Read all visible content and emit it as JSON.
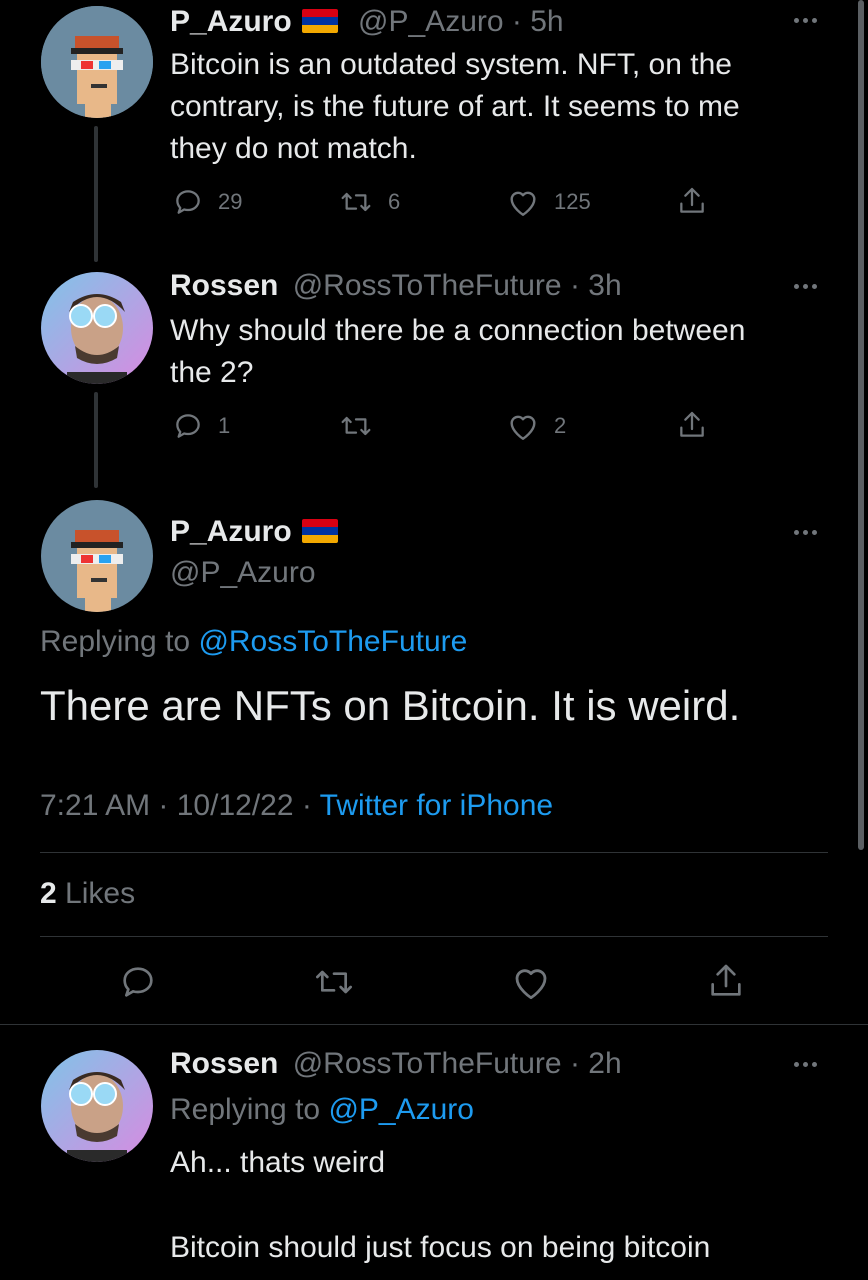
{
  "tweets": [
    {
      "name": "P_Azuro",
      "handle": "@P_Azuro",
      "time": "5h",
      "text_lines": [
        "Bitcoin is an outdated system. NFT, on the",
        "contrary, is the future of art. It seems to me",
        "they do not match."
      ],
      "replies": "29",
      "retweets": "6",
      "likes": "125"
    },
    {
      "name": "Rossen",
      "handle": "@RossToTheFuture",
      "time": "3h",
      "text_lines": [
        "Why should there be a connection between",
        "the 2?"
      ],
      "replies": "1",
      "retweets": "",
      "likes": "2"
    }
  ],
  "focus": {
    "name": "P_Azuro",
    "handle": "@P_Azuro",
    "replying_prefix": "Replying to",
    "replying_to": "@RossToTheFuture",
    "text": "There are NFTs on Bitcoin. It is weird.",
    "time": "7:21 AM",
    "date": "10/12/22",
    "client": "Twitter for iPhone",
    "likes_count": "2",
    "likes_label": "Likes"
  },
  "reply": {
    "name": "Rossen",
    "handle": "@RossToTheFuture",
    "time": "2h",
    "replying_prefix": "Replying to",
    "replying_to": "@P_Azuro",
    "line1": "Ah... thats weird",
    "line2": "Bitcoin should just focus on being bitcoin"
  },
  "colors": {
    "background": "#000000",
    "text": "#e7e9ea",
    "muted": "#71767b",
    "link": "#1d9bf0"
  },
  "flag": {
    "colors": [
      "#d90012",
      "#0033a0",
      "#f2a800"
    ]
  }
}
